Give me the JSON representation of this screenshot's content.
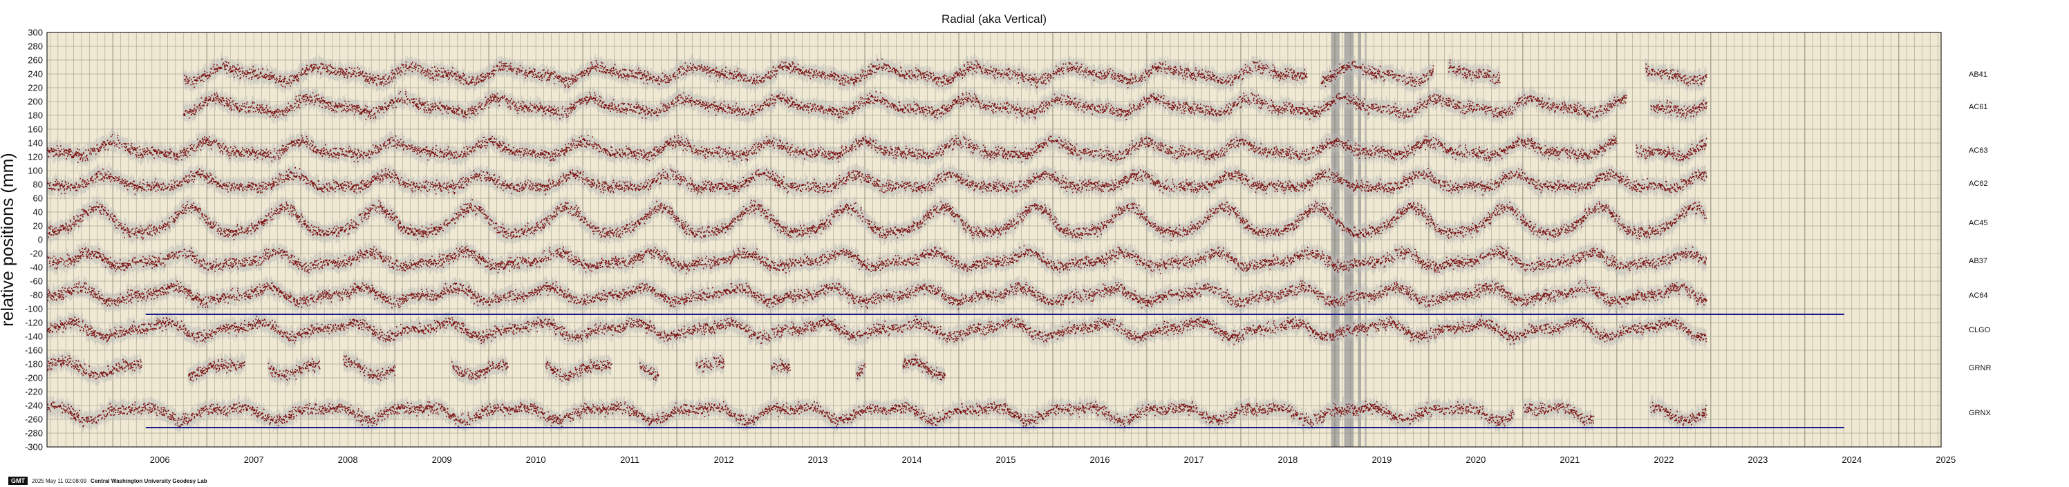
{
  "chart_data": {
    "type": "scatter",
    "title": "Radial (aka Vertical)",
    "ylabel": "relative positions (mm)",
    "xlabel": "",
    "xlim": [
      2005.3,
      2025.45
    ],
    "ylim": [
      -300,
      300
    ],
    "x_ticks": [
      "2006",
      "2007",
      "2008",
      "2009",
      "2010",
      "2011",
      "2012",
      "2013",
      "2014",
      "2015",
      "2016",
      "2017",
      "2018",
      "2019",
      "2020",
      "2021",
      "2022",
      "2023",
      "2024",
      "2025"
    ],
    "y_ticks": [
      300,
      280,
      260,
      240,
      220,
      200,
      180,
      160,
      140,
      120,
      100,
      80,
      60,
      40,
      20,
      0,
      -20,
      -40,
      -60,
      -80,
      -100,
      -120,
      -140,
      -160,
      -180,
      -200,
      -220,
      -240,
      -260,
      -280,
      -300
    ],
    "grid": true,
    "series": [
      {
        "name": "AB41",
        "offset": 240,
        "start": 2006.75,
        "end": 2022.95,
        "gaps": [
          [
            2018.7,
            2018.85
          ],
          [
            2020.05,
            2020.2
          ],
          [
            2020.75,
            2022.3
          ]
        ]
      },
      {
        "name": "AC61",
        "offset": 193,
        "start": 2006.75,
        "end": 2022.95,
        "gaps": [
          [
            2022.1,
            2022.35
          ]
        ]
      },
      {
        "name": "AC63",
        "offset": 130,
        "start": 2005.3,
        "end": 2022.95,
        "gaps": [
          [
            2022.0,
            2022.2
          ]
        ]
      },
      {
        "name": "AC62",
        "offset": 82,
        "start": 2005.3,
        "end": 2022.95,
        "gaps": []
      },
      {
        "name": "AC45",
        "offset": 25,
        "start": 2005.3,
        "end": 2022.95,
        "gaps": []
      },
      {
        "name": "AB37",
        "offset": -30,
        "start": 2005.3,
        "end": 2022.95,
        "gaps": []
      },
      {
        "name": "AC64",
        "offset": -80,
        "start": 2005.3,
        "end": 2022.95,
        "gaps": []
      },
      {
        "name": "CLGO",
        "offset": -130,
        "start": 2005.3,
        "end": 2022.95,
        "gaps": []
      },
      {
        "name": "GRNR",
        "offset": -185,
        "start": 2005.3,
        "end": 2014.85,
        "gaps": [
          [
            2006.3,
            2006.8
          ],
          [
            2007.4,
            2007.65
          ],
          [
            2008.2,
            2008.45
          ],
          [
            2009.0,
            2009.6
          ],
          [
            2010.2,
            2010.6
          ],
          [
            2011.3,
            2011.6
          ],
          [
            2011.8,
            2012.2
          ],
          [
            2012.5,
            2013.0
          ],
          [
            2013.2,
            2013.9
          ],
          [
            2014.0,
            2014.4
          ]
        ]
      },
      {
        "name": "GRNX",
        "offset": -250,
        "start": 2005.3,
        "end": 2022.95,
        "gaps": [
          [
            2020.9,
            2021.0
          ],
          [
            2021.75,
            2022.35
          ]
        ]
      }
    ],
    "reference_lines": [
      {
        "y": -108,
        "x": [
          2006.35,
          2024.42
        ],
        "color": "#1a1a8c"
      },
      {
        "y": -272,
        "x": [
          2006.35,
          2024.42
        ],
        "color": "#1a1a8c"
      }
    ],
    "shaded_bands": [
      [
        2018.96,
        2019.05
      ],
      [
        2019.1,
        2019.2
      ],
      [
        2019.25,
        2019.28
      ],
      [
        2019.32,
        2019.33
      ]
    ],
    "colors": {
      "plot_background": "#efe8d2",
      "data_point": "#7a1010",
      "uncertainty": "#b9b9b9",
      "grid": "#8a8a7a",
      "band": "#9a9a9a"
    }
  },
  "footer": {
    "logo": "GMT",
    "timestamp": "2025 May 11 02:08:09",
    "org": "Central Washington University Geodesy Lab"
  }
}
